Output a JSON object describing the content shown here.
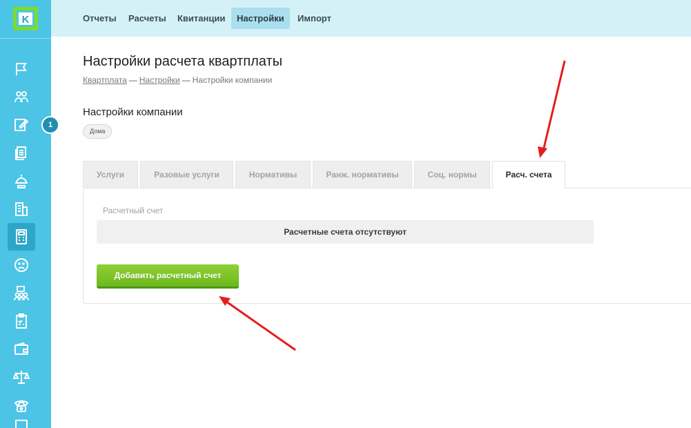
{
  "topnav": {
    "items": [
      {
        "label": "Отчеты",
        "active": false
      },
      {
        "label": "Расчеты",
        "active": false
      },
      {
        "label": "Квитанции",
        "active": false
      },
      {
        "label": "Настройки",
        "active": true
      },
      {
        "label": "Импорт",
        "active": false
      }
    ]
  },
  "sidebar": {
    "logo_letter": "K",
    "notification_count": "1",
    "items": [
      {
        "icon": "flag-icon",
        "active": false
      },
      {
        "icon": "users-icon",
        "active": false
      },
      {
        "icon": "edit-icon",
        "active": false
      },
      {
        "icon": "documents-icon",
        "active": false
      },
      {
        "icon": "bell-stand-icon",
        "active": false
      },
      {
        "icon": "building-icon",
        "active": false
      },
      {
        "icon": "calculator-icon",
        "active": true
      },
      {
        "icon": "sad-face-icon",
        "active": false
      },
      {
        "icon": "team-icon",
        "active": false
      },
      {
        "icon": "checklist-icon",
        "active": false
      },
      {
        "icon": "wallet-icon",
        "active": false
      },
      {
        "icon": "scales-icon",
        "active": false
      },
      {
        "icon": "phone-icon",
        "active": false
      }
    ]
  },
  "page": {
    "title": "Настройки расчета квартплаты",
    "breadcrumb": {
      "link1": "Квартплата",
      "link2": "Настройки",
      "current": "Настройки компании",
      "separator": "—"
    },
    "section_title": "Настройки компании",
    "chip": "Дома"
  },
  "tabs": [
    {
      "label": "Услуги",
      "active": false
    },
    {
      "label": "Разовые услуги",
      "active": false
    },
    {
      "label": "Нормативы",
      "active": false
    },
    {
      "label": "Ранж. нормативы",
      "active": false
    },
    {
      "label": "Соц. нормы",
      "active": false
    },
    {
      "label": "Расч. счета",
      "active": true
    }
  ],
  "panel": {
    "field_label": "Расчетный счет",
    "empty_text": "Расчетные счета отсутствуют",
    "add_button": "Добавить расчетный счет"
  },
  "colors": {
    "sidebar": "#4cc4e6",
    "topbar": "#d4f1f8",
    "accent_green": "#7cc428",
    "annotation_red": "#e31e1e"
  }
}
